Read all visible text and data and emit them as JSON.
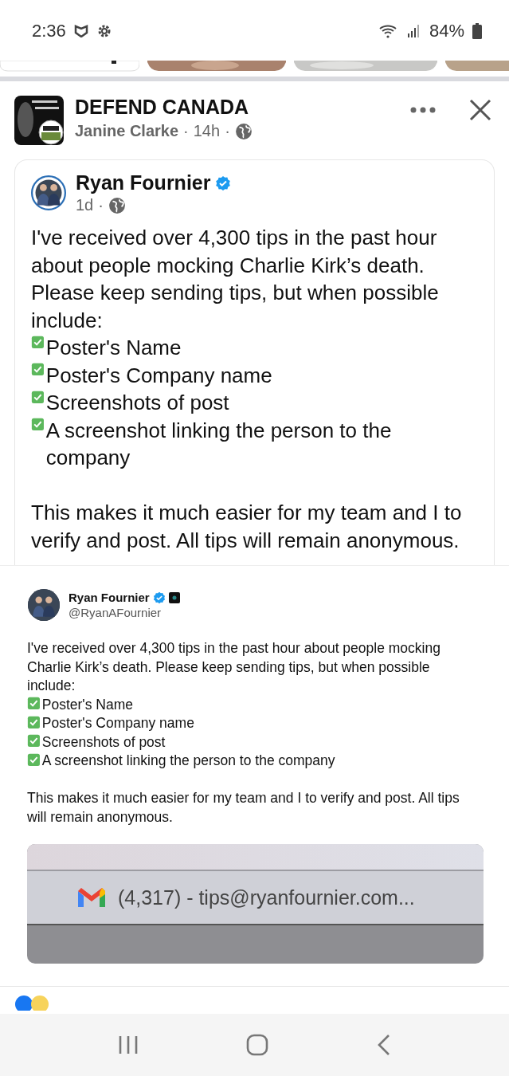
{
  "status_bar": {
    "time": "2:36",
    "battery": "84%"
  },
  "post": {
    "group": "DEFEND CANADA",
    "author": "Janine Clarke",
    "separator": "·",
    "time": "14h",
    "separator_2": "·"
  },
  "shared": {
    "author": "Ryan Fournier",
    "verified": true,
    "time": "1d",
    "separator": "·",
    "intro": "I've received over 4,300 tips in the past hour about people mocking Charlie Kirk’s death. Please keep sending tips, but when possible include:",
    "checklist": [
      "Poster's Name",
      "Poster's Company name",
      "Screenshots of post",
      "A screenshot linking the person to the company"
    ],
    "outro": "This makes it much easier for my team and I to verify and post. All tips will remain anonymous."
  },
  "tweet": {
    "name": "Ryan Fournier",
    "verified": true,
    "handle": "@RyanAFournier",
    "intro": "I've received over 4,300 tips in the past hour about people mocking Charlie Kirk’s death. Please keep sending tips, but when possible include:",
    "checklist": [
      "Poster's Name",
      "Poster's Company name",
      "Screenshots of post",
      "A screenshot linking the person to the company"
    ],
    "outro": "This makes it much easier for my team and I to verify and post. All tips will remain anonymous.",
    "inbox_tab": "(4,317) - tips@ryanfournier.com..."
  }
}
